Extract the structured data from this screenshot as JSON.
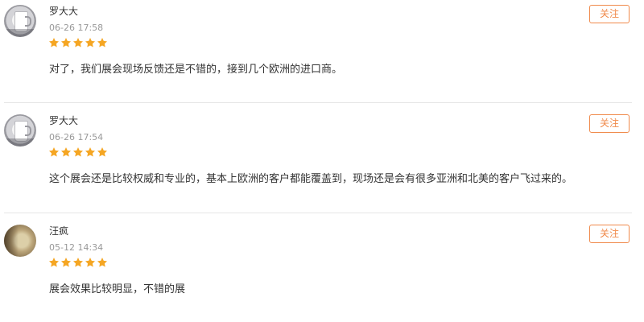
{
  "colors": {
    "accent": "#f08a4b",
    "star": "#f5a623",
    "text_primary": "#333333",
    "text_muted": "#999999",
    "divider": "#e6e6e6"
  },
  "reviews": [
    {
      "user": "罗大大",
      "avatar_icon": "mug-avatar",
      "time": "06-26 17:58",
      "rating": 5,
      "rating_max": 5,
      "comment": "对了，我们展会现场反馈还是不错的，接到几个欧洲的进口商。",
      "follow_label": "关注"
    },
    {
      "user": "罗大大",
      "avatar_icon": "mug-avatar",
      "time": "06-26 17:54",
      "rating": 5,
      "rating_max": 5,
      "comment": "这个展会还是比较权威和专业的，基本上欧洲的客户都能覆盖到，现场还是会有很多亚洲和北美的客户飞过来的。",
      "follow_label": "关注"
    },
    {
      "user": "汪疯",
      "avatar_icon": "face-avatar",
      "time": "05-12 14:34",
      "rating": 5,
      "rating_max": 5,
      "comment": "展会效果比较明显，不错的展",
      "follow_label": "关注"
    }
  ]
}
